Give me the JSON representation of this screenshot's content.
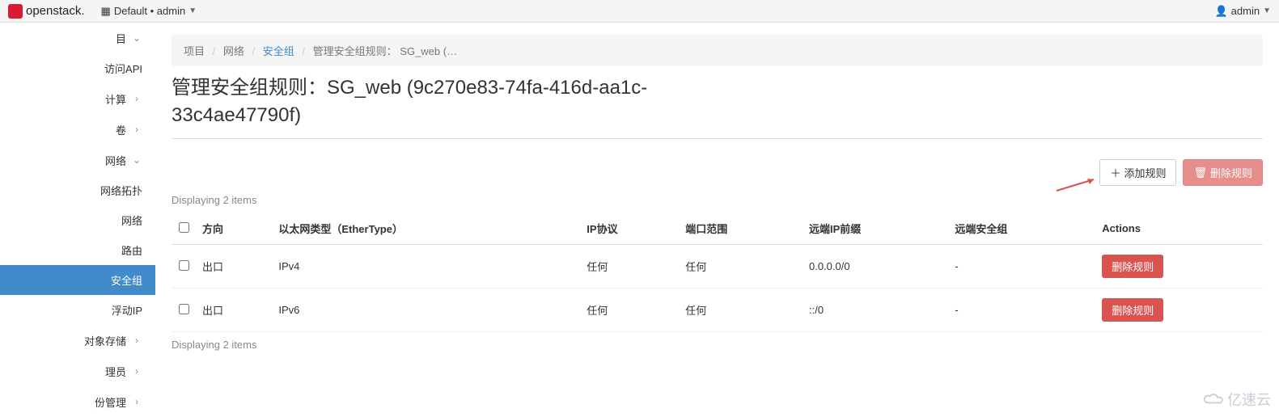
{
  "topbar": {
    "logo_text": "openstack.",
    "domain_label": "Default • admin",
    "user_label": "admin"
  },
  "sidebar": {
    "items": [
      {
        "label": "目",
        "kind": "group",
        "arrow": "down"
      },
      {
        "label": "访问API",
        "kind": "sub",
        "active": false
      },
      {
        "label": "计算",
        "kind": "group",
        "arrow": "right"
      },
      {
        "label": "卷",
        "kind": "group",
        "arrow": "right"
      },
      {
        "label": "网络",
        "kind": "group",
        "arrow": "down"
      },
      {
        "label": "网络拓扑",
        "kind": "sub",
        "active": false
      },
      {
        "label": "网络",
        "kind": "sub",
        "active": false
      },
      {
        "label": "路由",
        "kind": "sub",
        "active": false
      },
      {
        "label": "安全组",
        "kind": "sub",
        "active": true
      },
      {
        "label": "浮动IP",
        "kind": "sub",
        "active": false
      },
      {
        "label": "对象存储",
        "kind": "group",
        "arrow": "right"
      },
      {
        "label": "理员",
        "kind": "group",
        "arrow": "right"
      },
      {
        "label": "份管理",
        "kind": "group",
        "arrow": "right"
      }
    ]
  },
  "breadcrumb": {
    "project": "项目",
    "network": "网络",
    "secgroups": "安全组",
    "current": "管理安全组规则： SG_web (…"
  },
  "page_title": "管理安全组规则：SG_web (9c270e83-74fa-416d-aa1c-33c4ae47790f)",
  "toolbar": {
    "add_rule": "添加规则",
    "delete_rule": "删除规则"
  },
  "table": {
    "displaying": "Displaying 2 items",
    "headers": {
      "direction": "方向",
      "ethertype": "以太网类型（EtherType）",
      "protocol": "IP协议",
      "port_range": "端口范围",
      "remote_ip": "远端IP前缀",
      "remote_sg": "远端安全组",
      "actions": "Actions"
    },
    "rows": [
      {
        "direction": "出口",
        "ethertype": "IPv4",
        "protocol": "任何",
        "port_range": "任何",
        "remote_ip": "0.0.0.0/0",
        "remote_sg": "-",
        "action": "删除规则"
      },
      {
        "direction": "出口",
        "ethertype": "IPv6",
        "protocol": "任何",
        "port_range": "任何",
        "remote_ip": "::/0",
        "remote_sg": "-",
        "action": "删除规则"
      }
    ]
  },
  "watermark": "亿速云"
}
